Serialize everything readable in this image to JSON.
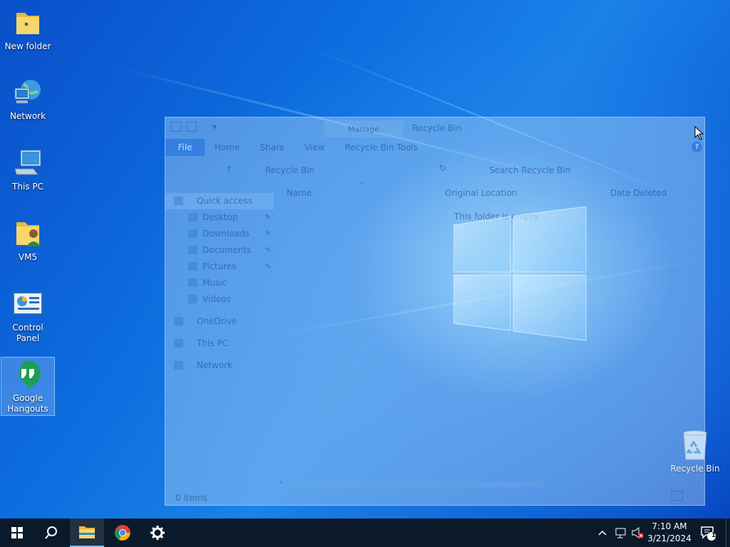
{
  "desktop": {
    "icons": [
      {
        "label": "New folder"
      },
      {
        "label": "Network"
      },
      {
        "label": "This PC"
      },
      {
        "label": "VM5"
      },
      {
        "label": "Control Panel"
      },
      {
        "label": "Google Hangouts"
      },
      {
        "label": "Recycle Bin"
      }
    ]
  },
  "explorer": {
    "title": "Recycle Bin",
    "manage_tab": "Manage",
    "ribbon_tabs": [
      "File",
      "Home",
      "Share",
      "View",
      "Recycle Bin Tools"
    ],
    "help": "?",
    "address_path": "Recycle Bin",
    "search_placeholder": "Search Recycle Bin",
    "nav": {
      "quick_access": "Quick access",
      "desktop": "Desktop",
      "downloads": "Downloads",
      "documents": "Documents",
      "pictures": "Pictures",
      "music": "Music",
      "videos": "Videos",
      "onedrive": "OneDrive",
      "this_pc": "This PC",
      "network": "Network"
    },
    "columns": {
      "name": "Name",
      "original_location": "Original Location",
      "date_deleted": "Date Deleted"
    },
    "empty_message": "This folder is empty.",
    "status": "0 items"
  },
  "taskbar": {
    "clock_time": "7:10 AM",
    "clock_date": "3/21/2024",
    "notification_count": "1",
    "colors": {
      "background": "#0b1a2b",
      "accent": "#76b9ed"
    }
  }
}
